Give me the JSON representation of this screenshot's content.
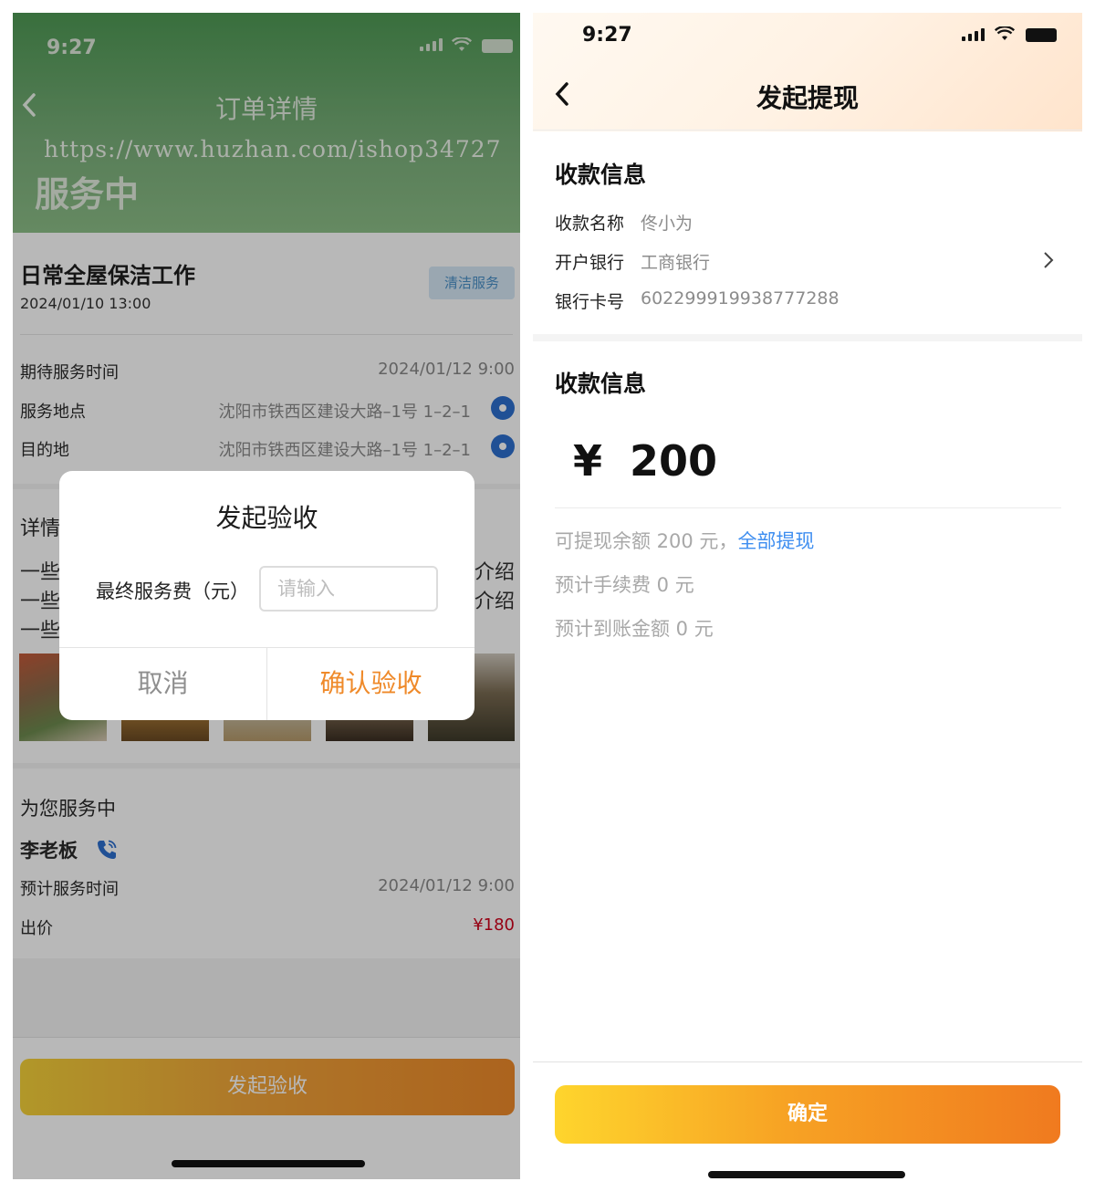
{
  "left": {
    "status_time": "9:27",
    "nav_title": "订单详情",
    "watermark": "https://www.huzhan.com/ishop34727",
    "order_status": "服务中",
    "service": {
      "title": "日常全屋保洁工作",
      "date": "2024/01/10 13:00",
      "tag": "清洁服务"
    },
    "info_rows": [
      {
        "label": "期待服务时间",
        "value": "2024/01/12 9:00"
      },
      {
        "label": "服务地点",
        "value": "沈阳市铁西区建设大路–1号 1–2–1"
      },
      {
        "label": "目的地",
        "value": "沈阳市铁西区建设大路–1号 1–2–1"
      }
    ],
    "detail_label": "详情",
    "desc_lines_left": [
      "一些",
      "一些",
      "一些"
    ],
    "desc_lines_right": [
      "介绍",
      "介绍"
    ],
    "provider": {
      "section_title": "为您服务中",
      "name": "李老板",
      "rows": [
        {
          "label": "预计服务时间",
          "value": "2024/01/12 9:00"
        },
        {
          "label": "出价",
          "value": "¥180"
        }
      ]
    },
    "dialog": {
      "title": "发起验收",
      "field_label": "最终服务费（元）",
      "input_placeholder": "请输入",
      "cancel": "取消",
      "confirm": "确认验收"
    },
    "bottom_button": "发起验收"
  },
  "right": {
    "status_time": "9:27",
    "nav_title": "发起提现",
    "payee_section_title": "收款信息",
    "payee": [
      {
        "label": "收款名称",
        "value": "佟小为"
      },
      {
        "label": "开户银行",
        "value": "工商银行"
      },
      {
        "label": "银行卡号",
        "value": "6022999199387772​88"
      }
    ],
    "amount_section_title": "收款信息",
    "currency": "¥",
    "amount": "200",
    "available_text": "可提现余额 200 元，",
    "withdraw_all": "全部提现",
    "fee_text": "预计手续费 0 元",
    "arrival_text": "预计到账金额 0 元",
    "confirm_button": "确定"
  },
  "colors": {
    "left_header_green": "#5fa362",
    "accent_orange": "#ef8a2a",
    "link_blue": "#3e8ef0",
    "price_red": "#d0021b",
    "tag_blue": "#4a90c8"
  }
}
